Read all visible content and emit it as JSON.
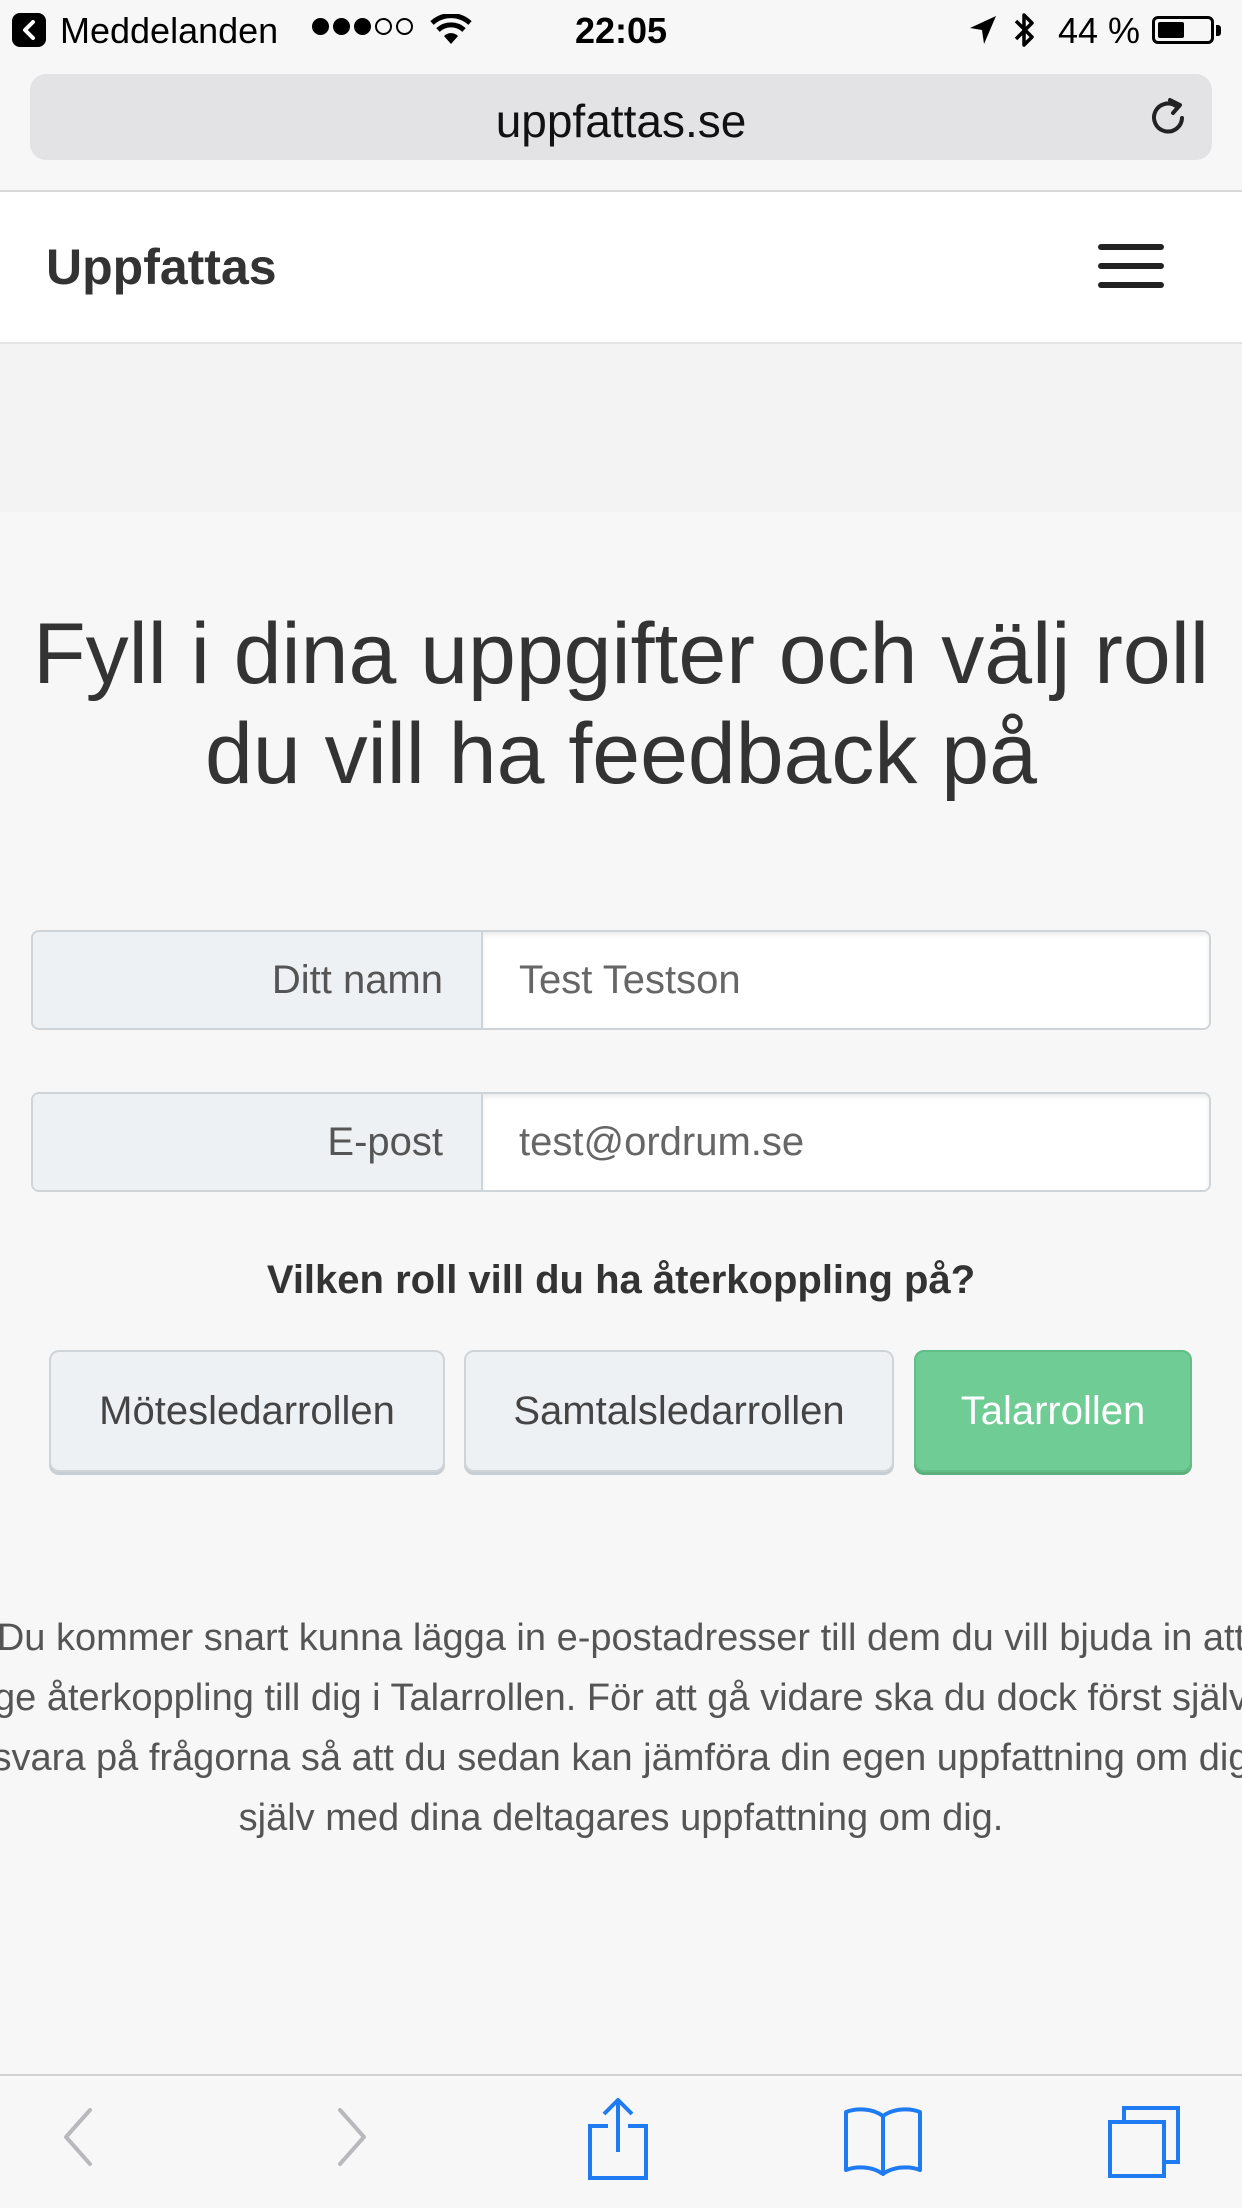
{
  "status_bar": {
    "back_app": "Meddelanden",
    "time": "22:05",
    "battery_percent": "44 %",
    "signal_dots_filled": 3,
    "signal_dots_total": 5
  },
  "browser": {
    "url": "uppfattas.se"
  },
  "navbar": {
    "brand": "Uppfattas"
  },
  "page": {
    "title": "Fyll i dina uppgifter och välj roll du vill ha feedback på",
    "form": {
      "name_label": "Ditt namn",
      "name_value": "Test Testson",
      "email_label": "E-post",
      "email_value": "test@ordrum.se"
    },
    "question": "Vilken roll vill du ha återkoppling på?",
    "roles": [
      {
        "label": "Mötesledarrollen",
        "active": false
      },
      {
        "label": "Samtalsledarrollen",
        "active": false
      },
      {
        "label": "Talarrollen",
        "active": true
      }
    ],
    "info_text": "Du kommer snart kunna lägga in e-postadresser till dem du vill bjuda in att ge återkoppling till dig i Talarrollen. För att gå vidare ska du dock först själv svara på frågorna så att du sedan kan jämföra din egen uppfattning om dig själv med dina deltagares uppfattning om dig."
  },
  "colors": {
    "accent_green": "#70cc95",
    "safari_blue": "#1f7bf2"
  },
  "toolbar": {
    "icons": [
      "back-icon",
      "forward-icon",
      "share-icon",
      "bookmarks-icon",
      "tabs-icon"
    ]
  }
}
